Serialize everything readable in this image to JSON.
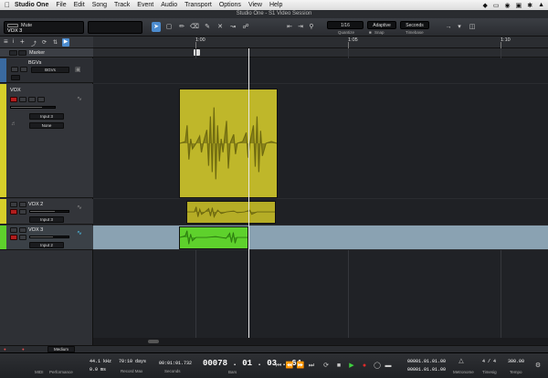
{
  "menubar": {
    "app_name": "Studio One",
    "items": [
      "File",
      "Edit",
      "Song",
      "Track",
      "Event",
      "Audio",
      "Transport",
      "Options",
      "View",
      "Help"
    ],
    "status_icons": [
      "dropbox-icon",
      "display-icon",
      "eye-icon",
      "lock-icon",
      "bluetooth-icon",
      "wifi-icon"
    ]
  },
  "window": {
    "title": "Studio One - S1 Video Session"
  },
  "toolbar": {
    "track_inspector_title": "Mute",
    "track_inspector_name": "VOX 3",
    "quantize_value": "1/16",
    "quantize_label": "Quantize",
    "snap_value": "Adaptive",
    "snap_label": "Snap",
    "timebase_value": "Seconds",
    "timebase_label": "Timebase"
  },
  "ruler": {
    "labels": [
      "1:00",
      "1:05",
      "1:10"
    ]
  },
  "marker_track": {
    "label": "Marker"
  },
  "tracks": [
    {
      "name": "BGVs",
      "type": "folder",
      "chip": "BGVs"
    },
    {
      "name": "VOX",
      "type": "audio",
      "input": "Input 3",
      "output": "None",
      "color": "#d6cf2a"
    },
    {
      "name": "VOX 2",
      "type": "audio",
      "input": "Input 3",
      "color": "#d6cf2a"
    },
    {
      "name": "VOX 3",
      "type": "audio",
      "input": "Input 2",
      "color": "#5ed12c"
    }
  ],
  "status_bar": {
    "audio_mode": "Medium"
  },
  "transport": {
    "midi_label": "MIDI",
    "performance_label": "Performance",
    "sample_rate": "44.1 kHz",
    "latency": "0.0 ms",
    "record_max_value": "70:10 days",
    "record_max_label": "Record Max",
    "seconds_value": "00:01:01.732",
    "seconds_label": "Seconds",
    "bars_value": "00078 . 01 . 03 . 64",
    "bars_label": "Bars",
    "loop_start": "00001.01.01.00",
    "loop_end": "00001.01.01.00",
    "metronome_label": "Metronome",
    "timesig_value": "4 / 4",
    "timesig_label": "Timesig",
    "tempo_value": "300.00",
    "tempo_label": "Tempo"
  },
  "colors": {
    "accent": "#4c8ccf",
    "vox_event": "#bfb72a",
    "vox3_event": "#5ed12c",
    "record": "#b11d1d"
  }
}
